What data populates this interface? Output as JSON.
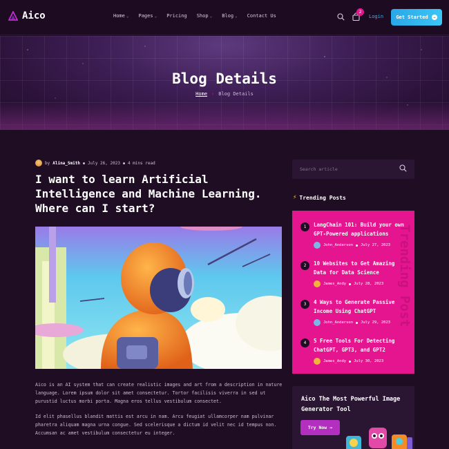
{
  "header": {
    "logo_text": "Aico",
    "nav": [
      {
        "label": "Home",
        "has_dropdown": true
      },
      {
        "label": "Pages",
        "has_dropdown": true
      },
      {
        "label": "Pricing",
        "has_dropdown": false
      },
      {
        "label": "Shop",
        "has_dropdown": true
      },
      {
        "label": "Blog",
        "has_dropdown": true
      },
      {
        "label": "Contact Us",
        "has_dropdown": false
      }
    ],
    "cart_count": "2",
    "login_label": "Login",
    "get_started_label": "Get Started",
    "chevron_glyph": "⌄",
    "arrow_glyph": "→"
  },
  "hero": {
    "title": "Blog Details",
    "breadcrumb_home": "Home",
    "breadcrumb_sep": "›",
    "breadcrumb_current": "Blog Details"
  },
  "article": {
    "by": "by",
    "author": "Alina_Smith",
    "date": "July 26, 2023",
    "read_time": "4 mins read",
    "title": "I want to learn Artificial Intelligence and Machine Learning. Where can I start?",
    "paragraphs": [
      "Aico is an AI system that can create realistic images and art from a description in nature language. Lorem ipsum dolor sit amet consectetur. Tortor facilisis viverra in sed ut purustid luctus morbi porta. Magna eros tellus vestibulum consectet.",
      "Id elit phasellus blandit mattis est arcu in nam. Arcu feugiat ullamcorper nam pulvinar pharetra aliquam magna urna congue. Sed scelerisque a dictum id velit nec id tempus non. Accumsan ac amet vestibulum consectetur eu integer."
    ]
  },
  "sidebar": {
    "search_placeholder": "Search article",
    "trending_heading": "Trending Posts",
    "trending_watermark": "Trending Post",
    "posts": [
      {
        "num": "1",
        "title": "LangChain 101: Build your own GPT-Powered applications",
        "author": "John_Anderson",
        "date": "July 27, 2023",
        "avatar_color": "#7ab8e8"
      },
      {
        "num": "2",
        "title": "10 Websites to Get Amazing Data for Data Science",
        "author": "James_Andy",
        "date": "July 28, 2023",
        "avatar_color": "#f2b33d"
      },
      {
        "num": "3",
        "title": "4 Ways to Generate Passive Income Using ChatGPT",
        "author": "John_Anderson",
        "date": "July 29, 2023",
        "avatar_color": "#7ab8e8"
      },
      {
        "num": "4",
        "title": "5 Free Tools For Detecting ChatGPT, GPT3, and GPT2",
        "author": "James_Andy",
        "date": "July 30, 2023",
        "avatar_color": "#f2b33d"
      }
    ],
    "promo_title": "Aico The Most Powerful Image Generator Tool",
    "promo_button": "Try Now"
  },
  "colors": {
    "accent_pink": "#e5148f",
    "accent_blue": "#29b8f5",
    "background": "#1f0d24"
  }
}
